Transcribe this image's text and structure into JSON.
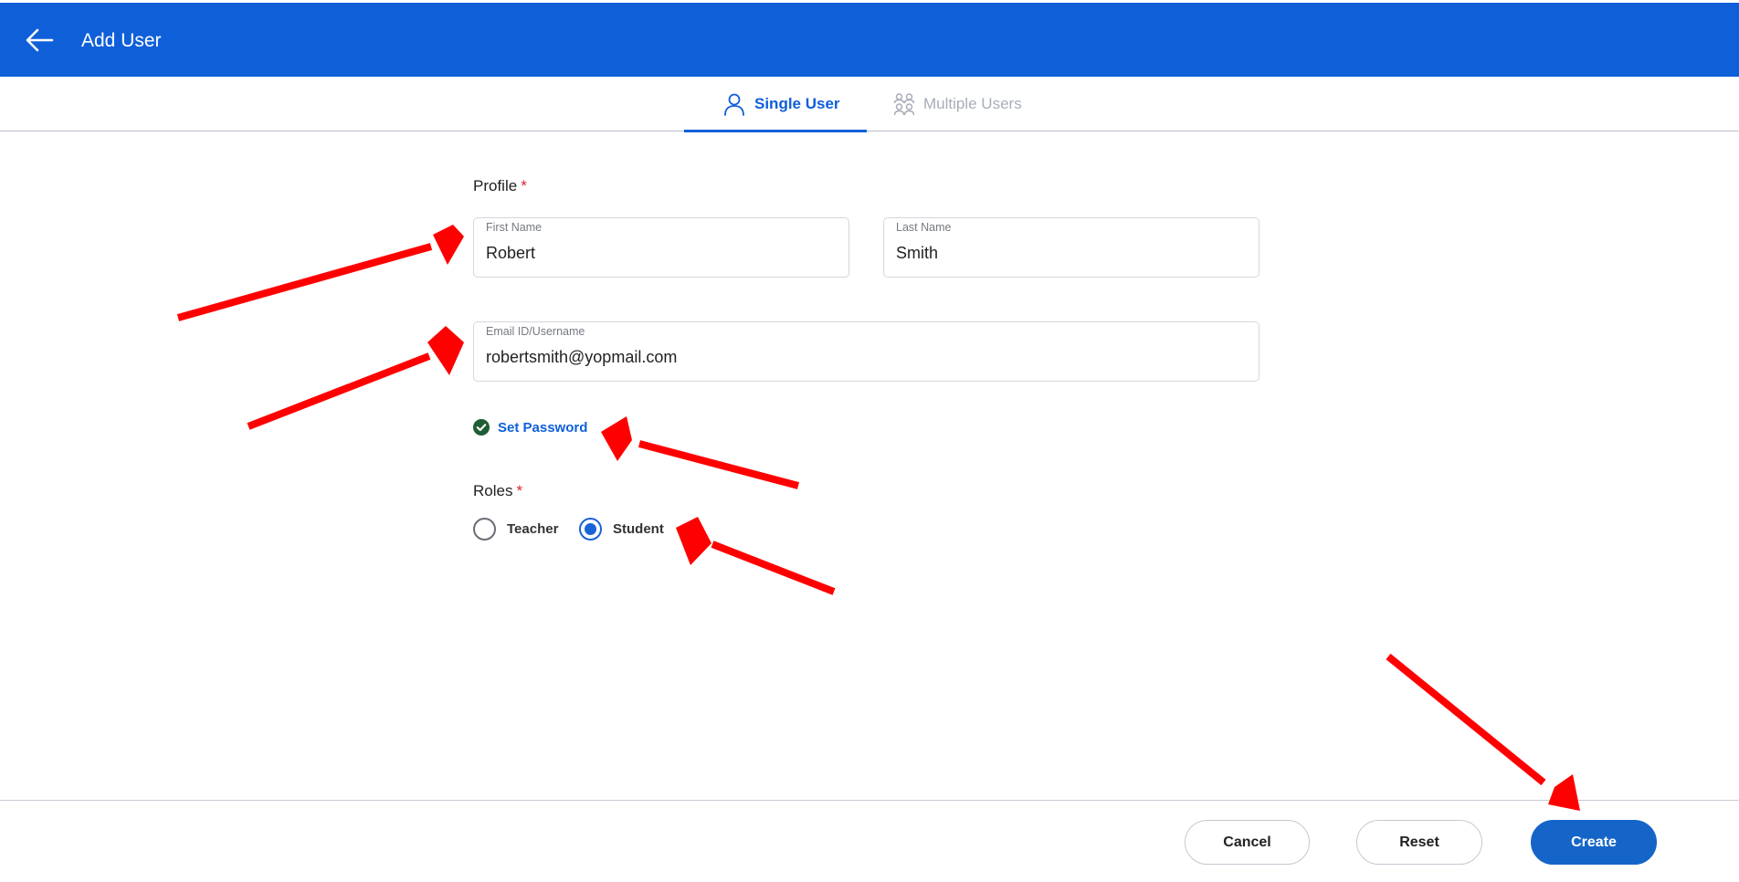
{
  "header": {
    "title": "Add User",
    "background_color": "#0f5fd9"
  },
  "tabs": [
    {
      "label": "Single User",
      "icon": "user-icon",
      "active": true
    },
    {
      "label": "Multiple Users",
      "icon": "users-icon",
      "active": false
    }
  ],
  "form": {
    "profile_label": "Profile",
    "required_marker": "*",
    "first_name": {
      "label": "First Name",
      "value": "Robert"
    },
    "last_name": {
      "label": "Last Name",
      "value": "Smith"
    },
    "email": {
      "label": "Email ID/Username",
      "value": "robertsmith@yopmail.com"
    },
    "set_password": {
      "label": "Set Password",
      "icon": "check-circle-icon",
      "done": true
    },
    "roles_label": "Roles",
    "roles": [
      {
        "label": "Teacher",
        "selected": false
      },
      {
        "label": "Student",
        "selected": true
      }
    ]
  },
  "footer": {
    "cancel_label": "Cancel",
    "reset_label": "Reset",
    "create_label": "Create"
  },
  "colors": {
    "primary": "#0f5fd9",
    "button_primary": "#1565c8",
    "required": "#e0222b",
    "success": "#1e5e33",
    "annotation_arrow": "#ff0000"
  }
}
